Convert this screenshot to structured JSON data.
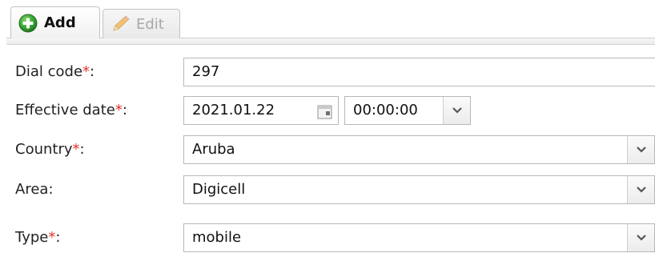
{
  "tabs": {
    "add_label": "Add",
    "edit_label": "Edit"
  },
  "form": {
    "dial_code": {
      "label": "Dial code",
      "required_mark": "*",
      "suffix": ":",
      "value": "297"
    },
    "effective_date": {
      "label": "Effective date",
      "required_mark": "*",
      "suffix": ":",
      "date_value": "2021.01.22",
      "time_value": "00:00:00"
    },
    "country": {
      "label": "Country",
      "required_mark": "*",
      "suffix": ":",
      "value": "Aruba"
    },
    "area": {
      "label": "Area",
      "suffix": ":",
      "value": "Digicell"
    },
    "type": {
      "label": "Type",
      "required_mark": "*",
      "suffix": ":",
      "value": "mobile"
    }
  },
  "colors": {
    "required_asterisk": "#e0322b",
    "add_icon_green": "#3aa537",
    "edit_icon_orange": "#f0b24a"
  },
  "icons": {
    "add_tab": "plus-circle-icon",
    "edit_tab": "pencil-icon",
    "date_picker": "calendar-icon",
    "dropdown": "chevron-down-icon"
  }
}
